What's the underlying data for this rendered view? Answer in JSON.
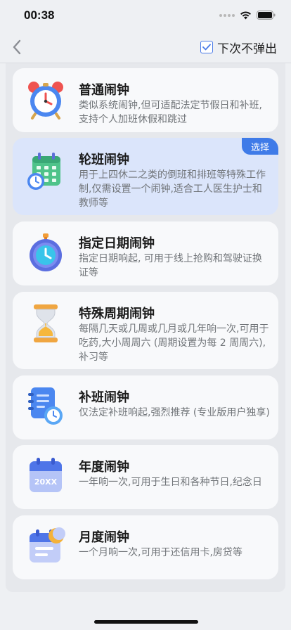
{
  "status": {
    "time": "00:38"
  },
  "nav": {
    "dont_show_again": "下次不弹出",
    "checked": true
  },
  "selected_badge": "选择",
  "cards": [
    {
      "title": "普通闹钟",
      "desc": "类似系统闹钟,但可适配法定节假日和补班,支持个人加班休假和跳过",
      "icon": "alarm-clock-icon"
    },
    {
      "title": "轮班闹钟",
      "desc": "用于上四休二之类的倒班和排班等特殊工作制,仅需设置一个闹钟,适合工人医生护士和教师等",
      "icon": "calendar-clock-icon",
      "selected": true
    },
    {
      "title": "指定日期闹钟",
      "desc": "指定日期响起, 可用于线上抢购和驾驶证换证等",
      "icon": "stopwatch-icon"
    },
    {
      "title": "特殊周期闹钟",
      "desc": "每隔几天或几周或几月或几年响一次,可用于吃药,大小周周六 (周期设置为每 2 周周六),补习等",
      "icon": "hourglass-icon"
    },
    {
      "title": "补班闹钟",
      "desc": "仅法定补班响起,强烈推荐 (专业版用户独享)",
      "icon": "notebook-clock-icon"
    },
    {
      "title": "年度闹钟",
      "desc": "一年响一次,可用于生日和各种节日,纪念日",
      "icon": "year-calendar-icon",
      "icon_text": "20XX"
    },
    {
      "title": "月度闹钟",
      "desc": "一个月响一次,可用于还信用卡,房贷等",
      "icon": "month-calendar-icon"
    }
  ]
}
